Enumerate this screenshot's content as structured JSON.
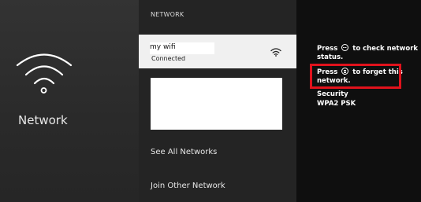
{
  "sidebar": {
    "title": "Network",
    "icon": "wifi-icon"
  },
  "list": {
    "header": "NETWORK",
    "selected_network": {
      "ssid": "my wifi",
      "status": "Connected",
      "icon": "wifi-signal-icon"
    },
    "items": [
      {
        "label": "See All Networks"
      },
      {
        "label": "Join Other Network"
      }
    ]
  },
  "info": {
    "check_prefix": "Press",
    "check_button_icon": "play-pause-button-icon",
    "check_suffix": "to check network",
    "check_line2": "status.",
    "forget_prefix": "Press",
    "forget_button_icon": "menu-button-icon",
    "forget_suffix": "to forget this",
    "forget_line2": "network.",
    "security_label": "Security",
    "security_value": "WPA2 PSK"
  },
  "colors": {
    "highlight": "#e1121c",
    "selected_bg": "#f0f0f0"
  }
}
